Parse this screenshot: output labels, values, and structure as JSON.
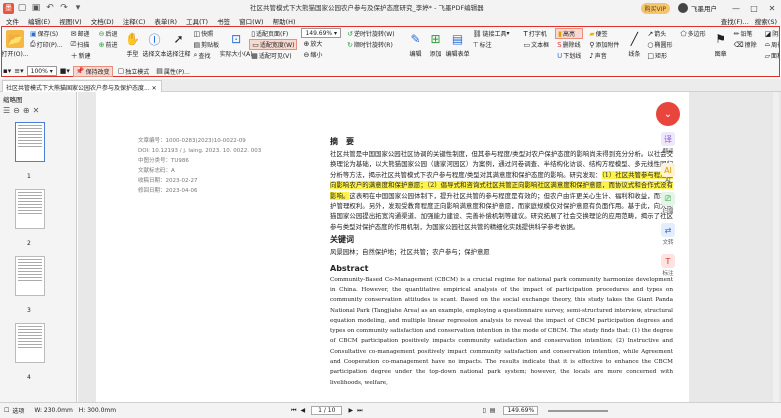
{
  "title": {
    "window_title": "社区共管模式下大熊猫国家公园农户参与及保护态度研究_李婷* - 飞墨PDF编辑器",
    "vip": "购买VIP",
    "user": "飞墨用户"
  },
  "menu": {
    "items": [
      "文件",
      "编辑(E)",
      "视图(V)",
      "文档(D)",
      "注释(C)",
      "表单(R)",
      "工具(T)",
      "书签",
      "窗口(W)",
      "帮助(H)"
    ],
    "right": [
      "查找(F)...",
      "搜索(S)"
    ]
  },
  "ribbon": {
    "open": "打开(O)...",
    "save": "保存(S)",
    "print": "打印(P)...",
    "convert": "转换",
    "mail": "邮递",
    "scan": "扫描",
    "new": "新建",
    "back": "后退",
    "forward": "前进",
    "hand": "手型",
    "select_text": "选择文本",
    "select_note": "选择注释",
    "snapshot": "快照",
    "clipboard": "剪贴板",
    "find": "查找",
    "actual_size": "实际大小(A)",
    "fit_page": "适配页面(F)",
    "fit_width": "适配宽度(W)",
    "fit_visible": "适配可见(V)",
    "zoom_value": "149.69%",
    "zoom_in": "放大",
    "zoom_out": "缩小",
    "rotate_ccw": "逆时针旋转(W)",
    "rotate_cw": "顺时针旋转(R)",
    "edit": "编辑",
    "add": "添加",
    "edit_form": "编辑表单",
    "link_tool": "链接工具",
    "textbox": "文本框",
    "label": "标注",
    "typewriter": "打字机",
    "highlight": "高亮",
    "strikeout": "删除线",
    "underline": "下划线",
    "note": "便签",
    "attach_file": "添加附件",
    "sound": "声音",
    "line": "线条",
    "arrow": "箭头",
    "ellipse": "椭圆形",
    "rect": "矩形",
    "polygon": "多边形",
    "pencil": "铅笔",
    "eraser": "擦除",
    "area_hl": "区域高亮",
    "stamp": "图章",
    "shadow": "阴影",
    "perimeter": "周长",
    "area": "面积"
  },
  "toolbar2": {
    "zoom": "100%",
    "keep_change": "保持改变",
    "standalone": "独立模式",
    "properties": "属性(P)..."
  },
  "tab": {
    "label": "社区共管模式下大熊猫国家公园农户参与及保护态度..."
  },
  "sidebar": {
    "title": "缩略图",
    "pages": [
      "1",
      "2",
      "3",
      "4"
    ]
  },
  "document": {
    "meta": [
      "文章编号：1000-0283(2023)10-0022-09",
      "DOI: 10.12193 / j. laing. 2023. 10. 0022. 003",
      "中图分类号：TU986",
      "文献标志码：A",
      "收稿日期：2023-02-27",
      "修回日期：2023-04-06"
    ],
    "abstract_heading": "摘　要",
    "abstract_pre": "社区共管是中国国家公园社区协调的关键性制度，但其参与程度/类型对农户保护态度的影响尚未得到充分分析。以社会交换理论为基础，以大熊猫国家公园（唐家河园区）为案例，通过问卷调查、半结构化访谈、结构方程模型、多元线性回归分析等方法，揭示社区共管模式下农户参与程度/类型对其满意度和保护态度的影响。研究发现：",
    "abstract_mark": "（1）社区共管参与程度正向影响农户的满意度和保护意愿；（2）倡导式和咨询式社区共管正向影响社区满意度和保护意愿，而协议式和合作式没有影响。",
    "abstract_post": "这表明在中国国家公园体制下，提升社区共管的参与程度是有效的；但农户由许更关心生计、福利和收益，而非保护管理权利。另外，发现受教育程度正向影响满意度和保护意愿，而家庭规模仅对保护意愿有负面作用。基于此，向大熊猫国家公园提出拓宽沟通渠道、加强能力建设、完善补偿机制等建议。研究拓展了社会交换理论的应用范畴，揭示了社区参与类型对保护态度的作用机制，为国家公园社区共管的精细化实践提供科学参考依据。",
    "kw_heading": "关键词",
    "keywords": "风景园林；自然保护地；社区共管；农户参与；保护意愿",
    "en_heading": "Abstract",
    "en_text": "Community-Based Co-Management (CBCM) is a crucial regime for national park community harmonize development in China. However, the quantitative empirical analysis of the impact of participation procedures and types on community conservation attitudes is scant. Based on the social exchange theory, this study takes the Giant Panda National Park (Tangjiahe Area) as an example, employing a questionnaire survey, semi-structured interview, structural equation modeling, and multiple linear regression analysis to reveal the impact of CBCM participation degrees and types on community satisfaction and conservation intention in the mode of CBCM. The study finds that: (1) the degree of CBCM participation positively impacts community satisfaction and conservation intention; (2) Instructive and Consultative co-management positively impact community satisfaction and conservation intention, while Agreement and Cooperation co-management have no impacts. The results indicate that it is effective to enhance the CBCM participation degree under the top-down national park system; however, the locals are more concerned with livelihoods, welfare,"
  },
  "float_tools": [
    "翻译",
    "AI",
    "扫描",
    "文转",
    "标注"
  ],
  "status": {
    "select": "选项",
    "width": "W: 230.0mm",
    "height": "H: 300.0mm",
    "page": "1 / 10",
    "zoom": "149.69%"
  },
  "colors": {
    "accent": "#e0312c",
    "highlight": "#fff34a",
    "vip": "#f4c56a"
  }
}
